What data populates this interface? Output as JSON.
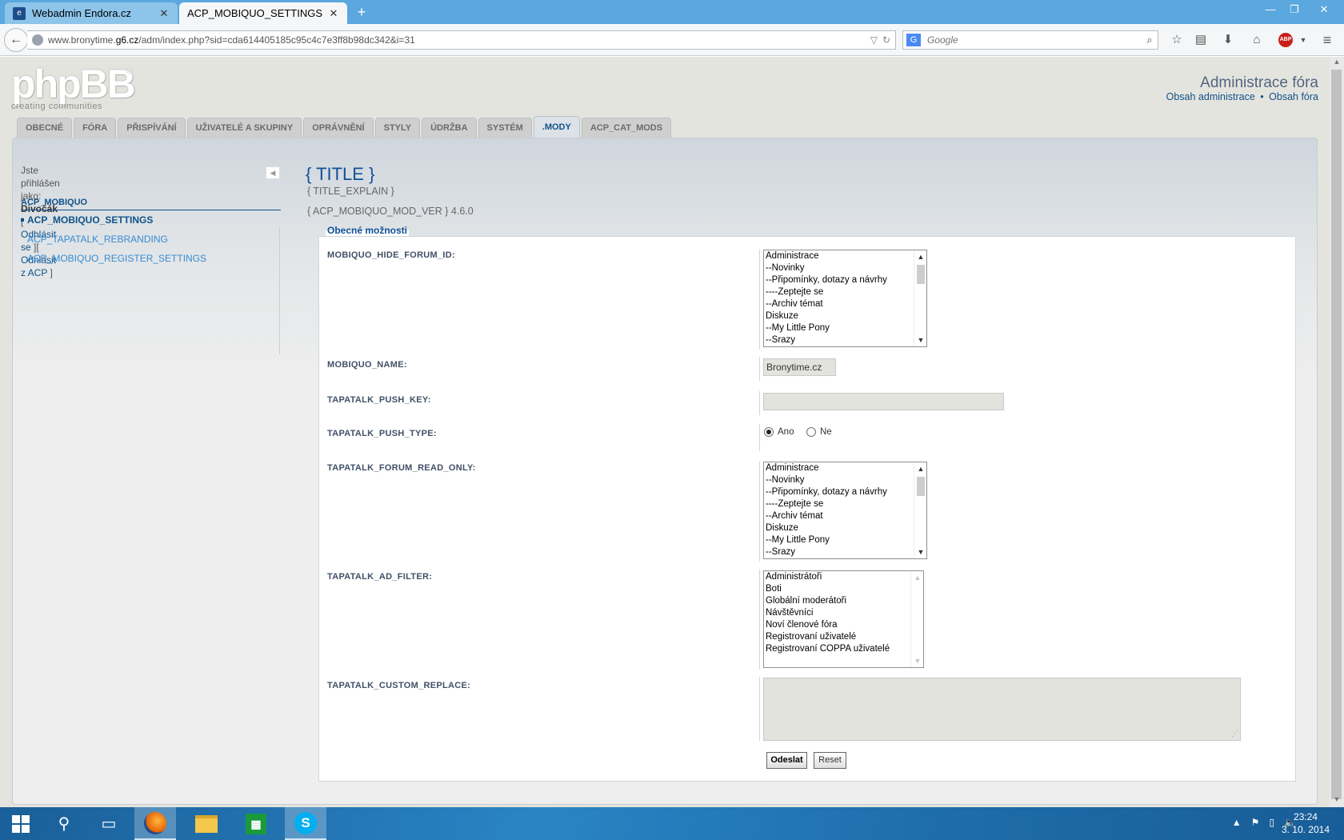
{
  "browser": {
    "tabs": [
      {
        "label": "Webadmin Endora.cz",
        "favicon": "endora-favicon",
        "active": false
      },
      {
        "label": "ACP_MOBIQUO_SETTINGS",
        "favicon": "",
        "active": true
      }
    ],
    "new_tab": "+",
    "url_prefix": "www.bronytime.",
    "url_domain": "g6.cz",
    "url_path": "/adm/index.php?sid=cda614405185c95c4c7e3ff8b98dc342&i=31",
    "search_engine": "G",
    "search_placeholder": "Google",
    "adblock_label": "ABP"
  },
  "header": {
    "logo_text": "phpBB",
    "logo_registered": "®",
    "logo_slogan": "creating  communities",
    "title": "Administrace fóra",
    "link_admin_index": "Obsah administrace",
    "link_separator": "•",
    "link_forum_index": "Obsah fóra"
  },
  "tabs": [
    {
      "label": "OBECNÉ",
      "active": false
    },
    {
      "label": "FÓRA",
      "active": false
    },
    {
      "label": "PŘISPÍVÁNÍ",
      "active": false
    },
    {
      "label": "UŽIVATELÉ A SKUPINY",
      "active": false
    },
    {
      "label": "OPRÁVNĚNÍ",
      "active": false
    },
    {
      "label": "STYLY",
      "active": false
    },
    {
      "label": "ÚDRŽBA",
      "active": false
    },
    {
      "label": "SYSTÉM",
      "active": false
    },
    {
      "label": ".MODY",
      "active": true
    },
    {
      "label": "ACP_CAT_MODS",
      "active": false
    }
  ],
  "sidebar": {
    "logged_in_as": "Jste přihlášen jako:",
    "username": "Divočák",
    "logout_open": "[",
    "logout": "Odhlásit se",
    "logout_mid": "][",
    "logout_acp": "Odhlásit z ACP",
    "logout_close": "]",
    "collapse_icon": "◀",
    "menu_header": "ACP_MOBIQUO",
    "items": [
      {
        "label": "ACP_MOBIQUO_SETTINGS",
        "active": true
      },
      {
        "label": "ACP_TAPATALK_REBRANDING",
        "active": false
      },
      {
        "label": "ACP_MOBIQUO_REGISTER_SETTINGS",
        "active": false
      }
    ]
  },
  "main": {
    "title": "{ TITLE }",
    "title_explain": "{ TITLE_EXPLAIN }",
    "mod_version": "{ ACP_MOBIQUO_MOD_VER } 4.6.0",
    "legend": "Obecné možnosti",
    "fields": {
      "hide_forum_id": {
        "label": "MOBIQUO_HIDE_FORUM_ID:",
        "options": [
          "Administrace",
          "--Novinky",
          "--Připomínky, dotazy a návrhy",
          "----Zeptejte se",
          "--Archiv témat",
          "Diskuze",
          "--My Little Pony",
          "--Srazy"
        ]
      },
      "mobiquo_name": {
        "label": "MOBIQUO_NAME:",
        "value": "Bronytime.cz"
      },
      "push_key": {
        "label": "TAPATALK_PUSH_KEY:",
        "value": ""
      },
      "push_type": {
        "label": "TAPATALK_PUSH_TYPE:",
        "yes": "Ano",
        "no": "Ne",
        "selected": "yes"
      },
      "forum_read_only": {
        "label": "TAPATALK_FORUM_READ_ONLY:",
        "options": [
          "Administrace",
          "--Novinky",
          "--Připomínky, dotazy a návrhy",
          "----Zeptejte se",
          "--Archiv témat",
          "Diskuze",
          "--My Little Pony",
          "--Srazy"
        ]
      },
      "ad_filter": {
        "label": "TAPATALK_AD_FILTER:",
        "options": [
          "Administrátoři",
          "Boti",
          "Globální moderátoři",
          "Návštěvníci",
          "Noví členové fóra",
          "Registrovaní uživatelé",
          "Registrovaní COPPA uživatelé"
        ]
      },
      "custom_replace": {
        "label": "TAPATALK_CUSTOM_REPLACE:",
        "value": ""
      }
    },
    "submit_label": "Odeslat",
    "reset_label": "Reset"
  },
  "taskbar": {
    "time": "23:24",
    "date": "3. 10. 2014"
  }
}
